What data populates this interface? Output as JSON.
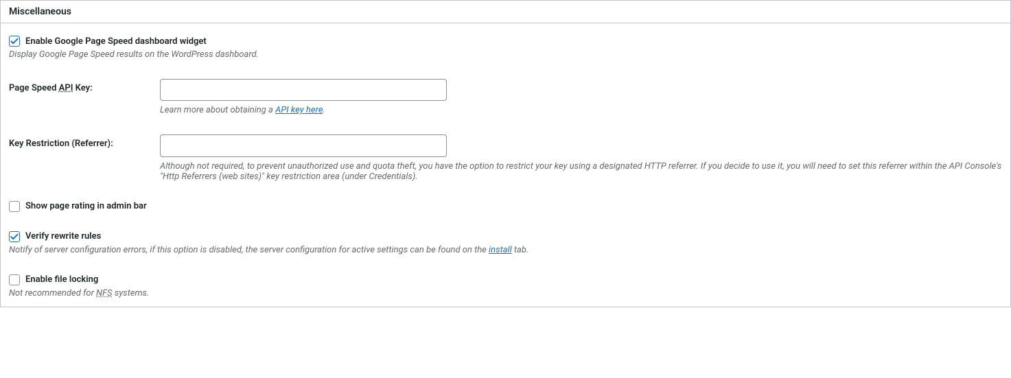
{
  "panel": {
    "title": "Miscellaneous"
  },
  "settings": {
    "enable_widget": {
      "label": "Enable Google Page Speed dashboard widget",
      "description": "Display Google Page Speed results on the WordPress dashboard."
    },
    "api_key": {
      "label_prefix": "Page Speed ",
      "label_abbr": "API",
      "label_suffix": " Key:",
      "value": "",
      "help_prefix": "Learn more about obtaining a ",
      "help_link": "API key here",
      "help_suffix": "."
    },
    "key_restriction": {
      "label": "Key Restriction (Referrer):",
      "value": "",
      "description": "Although not required, to prevent unauthorized use and quota theft, you have the option to restrict your key using a designated HTTP referrer. If you decide to use it, you will need to set this referrer within the API Console's \"Http Referrers (web sites)\" key restriction area (under Credentials)."
    },
    "show_rating": {
      "label": "Show page rating in admin bar"
    },
    "verify_rewrite": {
      "label": "Verify rewrite rules",
      "desc_prefix": "Notify of server configuration errors, if this option is disabled, the server configuration for active settings can be found on the ",
      "desc_link": "install",
      "desc_suffix": " tab."
    },
    "file_locking": {
      "label": "Enable file locking",
      "desc_prefix": "Not recommended for ",
      "desc_abbr": "NFS",
      "desc_suffix": " systems."
    }
  }
}
